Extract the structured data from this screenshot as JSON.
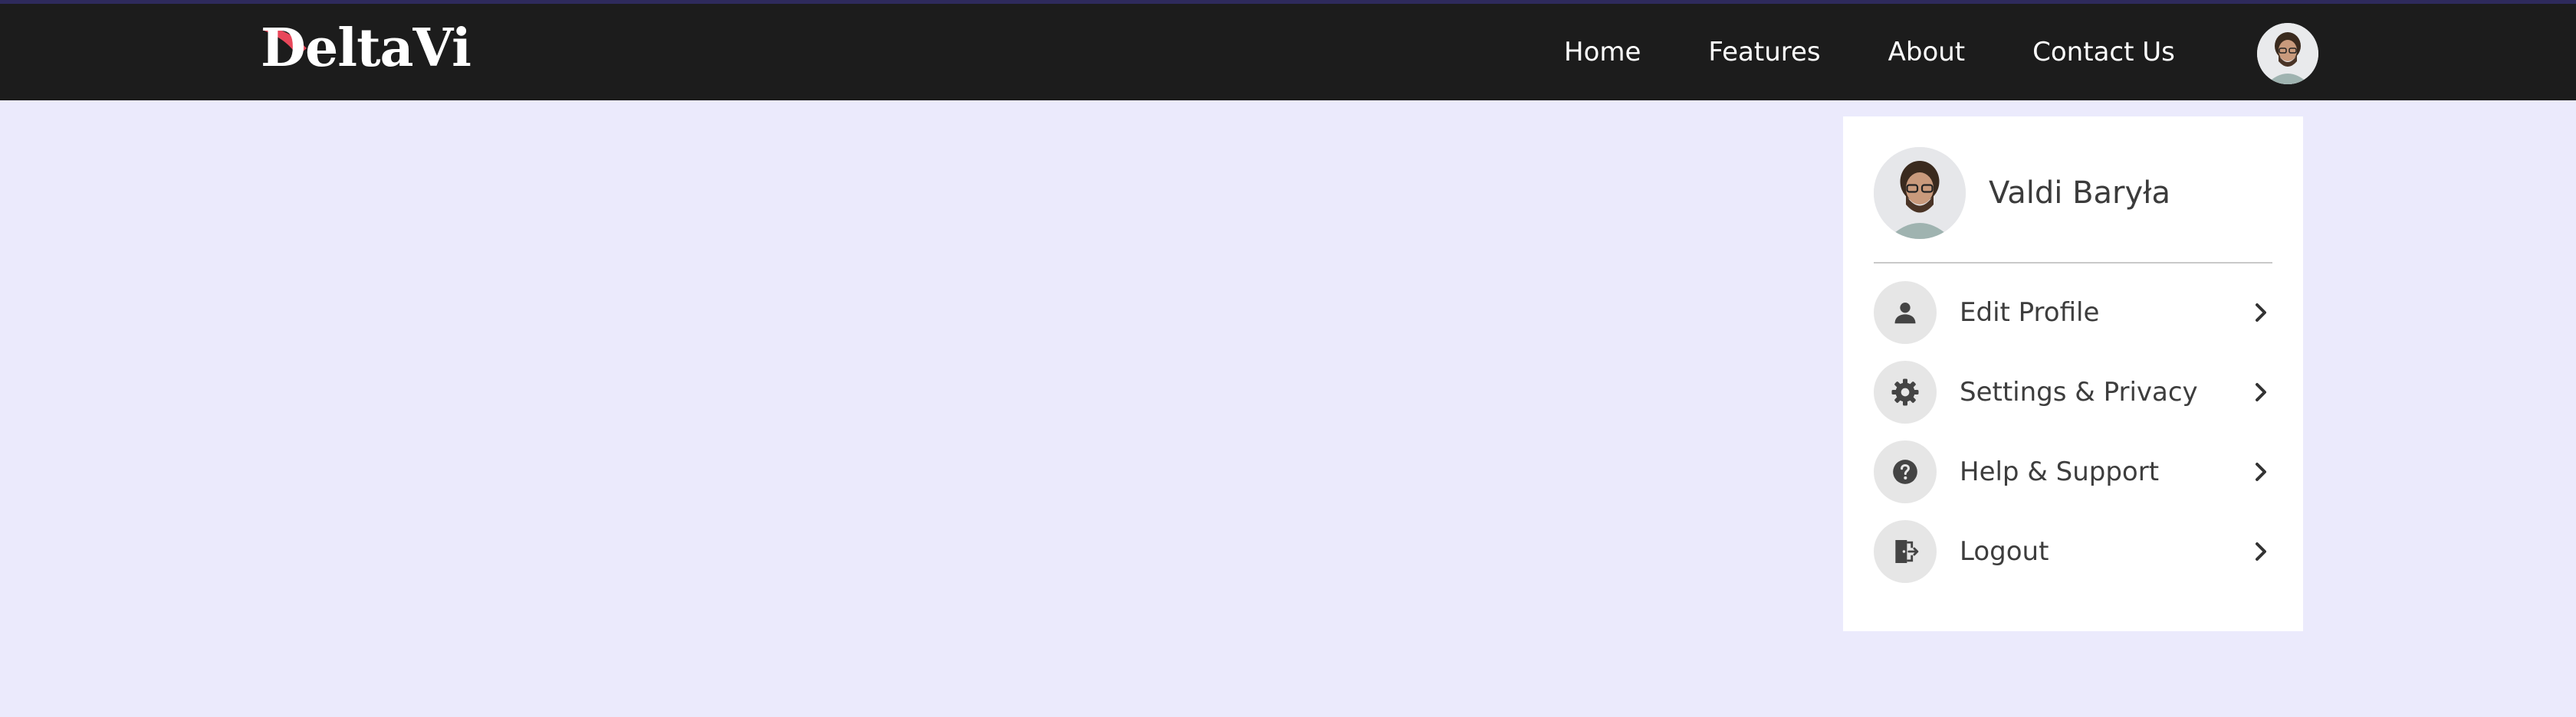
{
  "brand": {
    "name": "DeltaVi",
    "accent_color": "#e8475a"
  },
  "nav": {
    "links": [
      {
        "label": "Home"
      },
      {
        "label": "Features"
      },
      {
        "label": "About"
      },
      {
        "label": "Contact Us"
      }
    ],
    "avatar_icon": "user-avatar-photo"
  },
  "profile_menu": {
    "user_name": "Valdi Baryła",
    "items": [
      {
        "label": "Edit Profile",
        "icon": "user-icon"
      },
      {
        "label": "Settings & Privacy",
        "icon": "gear-icon"
      },
      {
        "label": "Help & Support",
        "icon": "help-icon"
      },
      {
        "label": "Logout",
        "icon": "logout-icon"
      }
    ],
    "chevron_icon": "chevron-right-icon"
  },
  "colors": {
    "navbar_bg": "#1c1c1c",
    "page_bg": "#ebeafc",
    "card_bg": "#ffffff",
    "icon_circle_bg": "#e6e6e6"
  }
}
